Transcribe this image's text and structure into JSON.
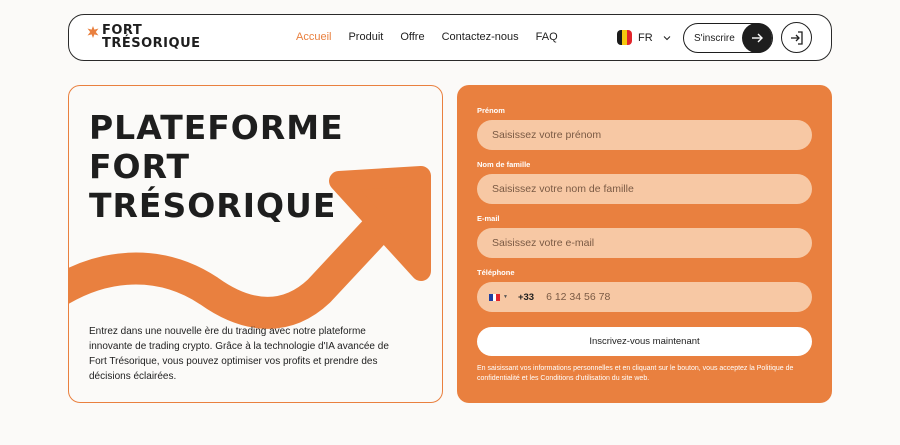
{
  "brand": {
    "line1": "FORT",
    "line2": "TRÉSORIQUE"
  },
  "nav": {
    "items": [
      {
        "label": "Accueil",
        "active": true
      },
      {
        "label": "Produit",
        "active": false
      },
      {
        "label": "Offre",
        "active": false
      },
      {
        "label": "Contactez-nous",
        "active": false
      },
      {
        "label": "FAQ",
        "active": false
      }
    ]
  },
  "language": {
    "code": "FR"
  },
  "header": {
    "signup_label": "S'inscrire"
  },
  "hero": {
    "title_lines": [
      "PLATEFORME",
      "FORT",
      "TRÉSORIQUE"
    ],
    "description": "Entrez dans une nouvelle ère du trading avec notre plateforme innovante de trading crypto. Grâce à la technologie d'IA avancée de Fort Trésorique, vous pouvez optimiser vos profits et prendre des décisions éclairées."
  },
  "form": {
    "first_name": {
      "label": "Prénom",
      "placeholder": "Saisissez votre prénom"
    },
    "last_name": {
      "label": "Nom de famille",
      "placeholder": "Saisissez votre nom de famille"
    },
    "email": {
      "label": "E-mail",
      "placeholder": "Saisissez votre e-mail"
    },
    "phone": {
      "label": "Téléphone",
      "code": "+33",
      "placeholder": "6 12 34 56 78"
    },
    "submit_label": "Inscrivez-vous maintenant",
    "legal": "En saisissant vos informations personnelles et en cliquant sur le bouton, vous acceptez la Politique de confidentialité et les Conditions d'utilisation du site web."
  },
  "colors": {
    "accent": "#e9803f",
    "field": "#f7c8a4",
    "dark": "#1e1e1e"
  }
}
